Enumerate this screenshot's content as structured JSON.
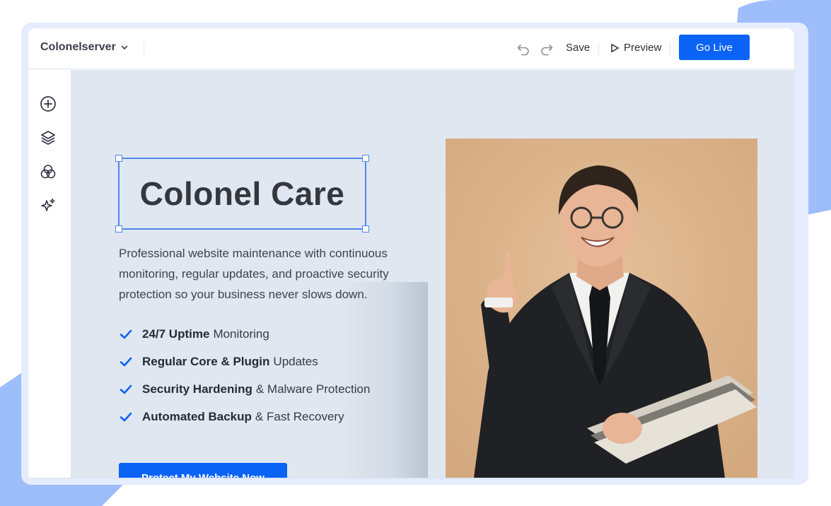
{
  "header": {
    "site_name": "Colonelserver",
    "save_label": "Save",
    "preview_label": "Preview",
    "golive_label": "Go Live"
  },
  "sidebar": {
    "tools": [
      {
        "icon": "add-icon"
      },
      {
        "icon": "layers-icon"
      },
      {
        "icon": "color-circles-icon"
      },
      {
        "icon": "sparkles-icon"
      }
    ]
  },
  "hero": {
    "headline": "Colonel Care",
    "description": "Professional website maintenance with continuous monitoring, regular updates, and proactive security protection so your business never slows down.",
    "features": [
      {
        "bold": "24/7 Uptime",
        "rest": "Monitoring"
      },
      {
        "bold": "Regular Core & Plugin",
        "rest": "Updates"
      },
      {
        "bold": "Security Hardening",
        "rest": "& Malware Protection"
      },
      {
        "bold": "Automated Backup",
        "rest": "& Fast Recovery"
      }
    ],
    "cta_label": "Protect My Website Now"
  },
  "colors": {
    "accent": "#0b63f6",
    "selection": "#4f86ef",
    "canvas_bg": "#e1e7f0",
    "photo_bg": "#d9b28a"
  }
}
